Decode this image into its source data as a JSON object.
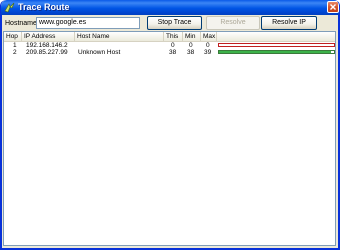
{
  "window": {
    "title": "Trace Route",
    "title_icon": "arrow-icon",
    "close_icon": "close-icon"
  },
  "toolbar": {
    "hostname_label": "Hostname:",
    "hostname_value": "www.google.es",
    "stop_trace_label": "Stop Trace",
    "resolve_hostname_label": "Resolve Hostname",
    "resolve_ip_label": "Resolve IP"
  },
  "table": {
    "columns": [
      "Hop",
      "IP Address",
      "Host Name",
      "This",
      "Min",
      "Max"
    ],
    "rows": [
      {
        "hop": "1",
        "ip": "192.168.146.2",
        "host": "",
        "this": "0",
        "min": "0",
        "max": "0",
        "bar_fraction": 0.0,
        "bar_color": "#e04040"
      },
      {
        "hop": "2",
        "ip": "209.85.227.99",
        "host": "Unknown Host",
        "this": "38",
        "min": "38",
        "max": "39",
        "bar_fraction": 0.97,
        "bar_color": "#3cb34a"
      }
    ]
  },
  "colors": {
    "titlebar": "#0055e5",
    "close_button": "#d6552c",
    "dialog_background": "#ece9d8"
  }
}
